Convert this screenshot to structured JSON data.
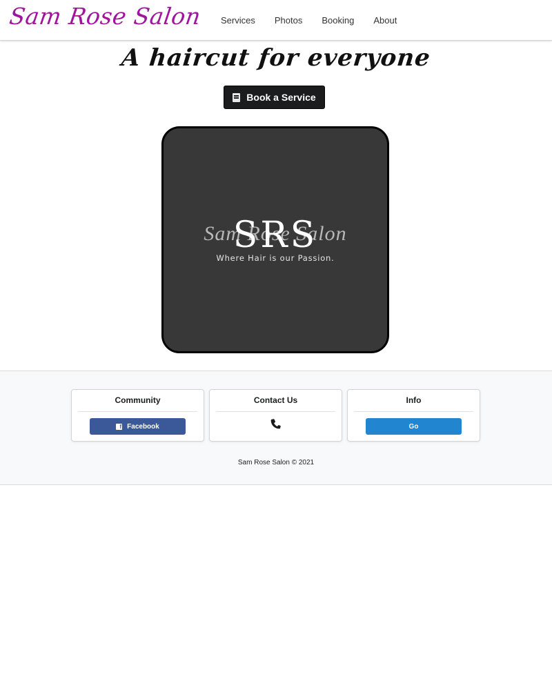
{
  "header": {
    "brand": "Sam Rose Salon",
    "nav": [
      {
        "label": "Services"
      },
      {
        "label": "Photos"
      },
      {
        "label": "Booking"
      },
      {
        "label": "About"
      }
    ]
  },
  "hero": {
    "tagline": "A haircut for everyone",
    "book_button": {
      "label": "Book a Service",
      "icon": "book-icon"
    }
  },
  "logo": {
    "monogram": "SRS",
    "script_name": "Sam Rose Salon",
    "slogan": "Where Hair is our Passion."
  },
  "footer": {
    "cards": [
      {
        "title": "Community",
        "button_label": "Facebook",
        "button_icon": "facebook-icon"
      },
      {
        "title": "Contact Us",
        "icon": "phone-icon"
      },
      {
        "title": "Info",
        "button_label": "Go"
      }
    ],
    "copyright": "Sam Rose Salon © 2021"
  },
  "colors": {
    "brand": "#a0159e",
    "dark_button": "#1b1c1d",
    "facebook": "#3b5998",
    "go_button": "#2185d0",
    "logo_background": "#383838"
  }
}
